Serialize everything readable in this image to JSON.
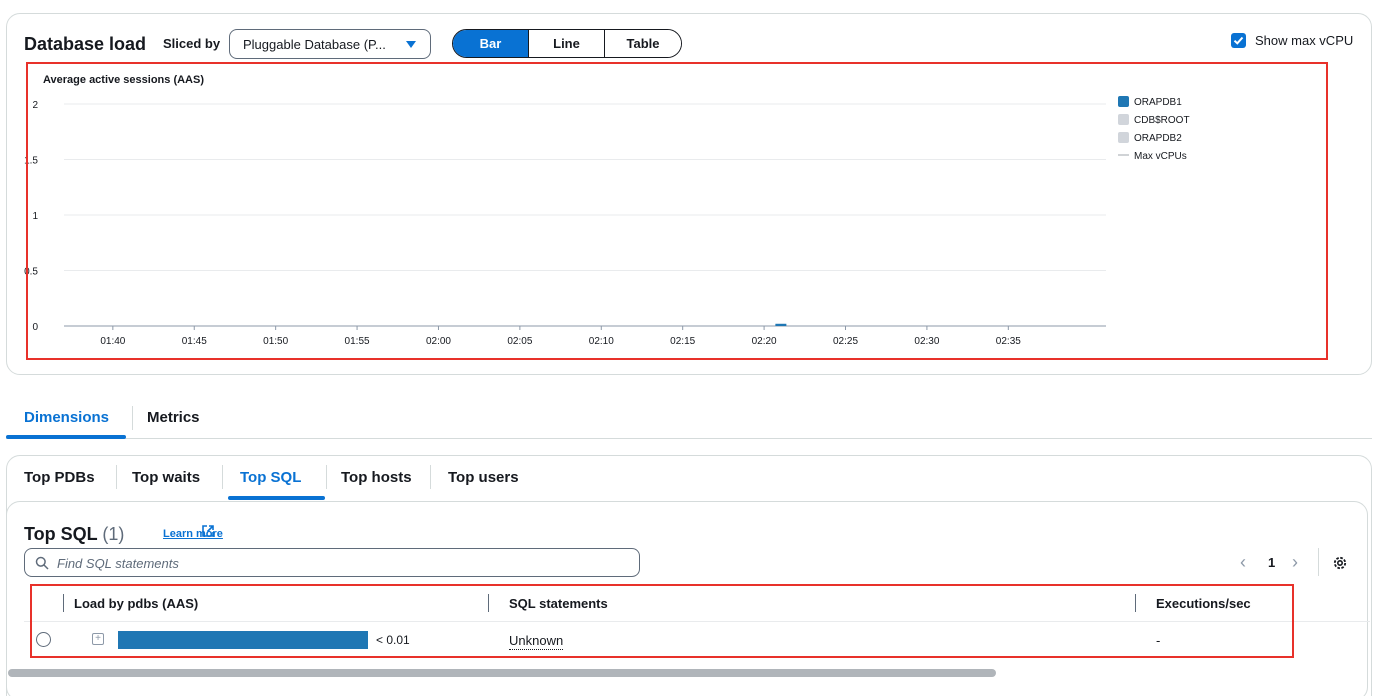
{
  "header": {
    "title": "Database load",
    "sliced_by_label": "Sliced by",
    "select_value": "Pluggable Database (P...",
    "view_buttons": [
      "Bar",
      "Line",
      "Table"
    ],
    "active_view": "Bar",
    "show_max_label": "Show max vCPU",
    "show_max_checked": true
  },
  "chart_data": {
    "type": "bar",
    "ylabel": "Average active sessions (AAS)",
    "ylim": [
      0,
      2
    ],
    "y_ticks": [
      "2",
      "1.5",
      "1",
      "0.5",
      "0"
    ],
    "y_tick_values": [
      2,
      1.5,
      1,
      0.5,
      0
    ],
    "x_ticks": [
      "01:40",
      "01:45",
      "01:50",
      "01:55",
      "02:00",
      "02:05",
      "02:10",
      "02:15",
      "02:20",
      "02:25",
      "02:30",
      "02:35"
    ],
    "x_range_minutes": [
      97,
      161
    ],
    "series": [
      {
        "name": "ORAPDB1",
        "color": "#1f77b4",
        "points": [
          {
            "t": 141,
            "value": 0.02
          }
        ]
      },
      {
        "name": "CDB$ROOT",
        "color": "#d1d5db",
        "points": []
      },
      {
        "name": "ORAPDB2",
        "color": "#d1d5db",
        "points": []
      }
    ],
    "max_line_label": "Max vCPUs",
    "legend_position": "right",
    "grid": true
  },
  "main_tabs": [
    {
      "label": "Dimensions",
      "active": true
    },
    {
      "label": "Metrics",
      "active": false
    }
  ],
  "sub_tabs": [
    {
      "label": "Top PDBs"
    },
    {
      "label": "Top waits"
    },
    {
      "label": "Top SQL"
    },
    {
      "label": "Top hosts"
    },
    {
      "label": "Top users"
    }
  ],
  "active_sub_tab": "Top SQL",
  "top_sql": {
    "title": "Top SQL",
    "count": "(1)",
    "learn_more": "Learn more",
    "search_placeholder": "Find SQL statements",
    "page": "1",
    "columns": [
      "Load by pdbs (AAS)",
      "SQL statements",
      "Executions/sec"
    ],
    "rows": [
      {
        "load_value": "< 0.01",
        "load_fraction": 1.0,
        "sql": "Unknown",
        "executions": "-"
      }
    ]
  },
  "colors": {
    "accent": "#0972d3",
    "bar": "#1f77b4",
    "highlight_border": "#e8312a"
  }
}
